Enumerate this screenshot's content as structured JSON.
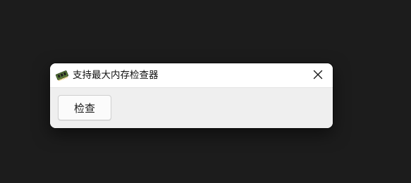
{
  "window": {
    "title": "支持最大内存检查器",
    "app_icon": "memory-chip-icon",
    "close_icon": "close-icon"
  },
  "content": {
    "check_button_label": "检查"
  },
  "colors": {
    "desktop_background": "#1c1c1c",
    "titlebar_background": "#ffffff",
    "client_background": "#efefef",
    "button_background": "#fbfbfb",
    "button_border": "#cfcfcf"
  }
}
